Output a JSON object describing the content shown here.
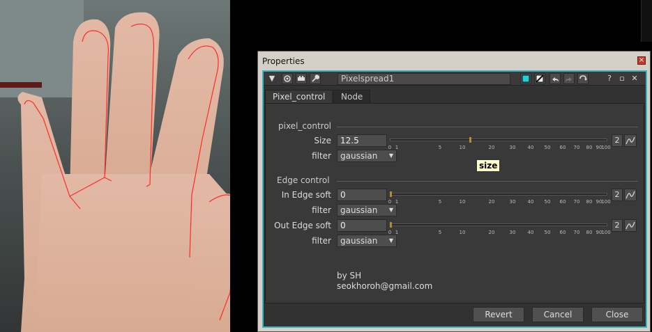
{
  "properties": {
    "title": "Properties",
    "close_glyph": "×"
  },
  "node": {
    "name": "Pixelspread1"
  },
  "toolbar": {
    "version_number": "2",
    "help_glyph": "?",
    "float_glyph": "▫",
    "close_glyph": "✕",
    "accent": "#37b7c4",
    "swatch_color": "#20d0d8"
  },
  "tabs": [
    {
      "label": "Pixel_control",
      "active": true
    },
    {
      "label": "Node",
      "active": false
    }
  ],
  "pixel_control": {
    "section_label": "pixel_control",
    "size": {
      "label": "Size",
      "value": "12.5",
      "slider_value": 12.5
    },
    "filter": {
      "label": "filter",
      "value": "gaussian"
    },
    "tooltip": "size"
  },
  "edge_control": {
    "section_label": "Edge control",
    "in_edge": {
      "label": "In Edge soft",
      "value": "0",
      "slider_value": 0
    },
    "in_filter": {
      "label": "filter",
      "value": "gaussian"
    },
    "out_edge": {
      "label": "Out Edge soft",
      "value": "0",
      "slider_value": 0
    },
    "out_filter": {
      "label": "filter",
      "value": "gaussian"
    }
  },
  "slider_ticks": [
    "0",
    "1",
    "5",
    "10",
    "20",
    "30",
    "40",
    "50",
    "60",
    "70",
    "80",
    "90",
    "100"
  ],
  "anim_button_label": "2",
  "credits": {
    "line1": "by SH",
    "line2": "seokhoroh@gmail.com"
  },
  "footer": {
    "revert": "Revert",
    "cancel": "Cancel",
    "close": "Close"
  }
}
